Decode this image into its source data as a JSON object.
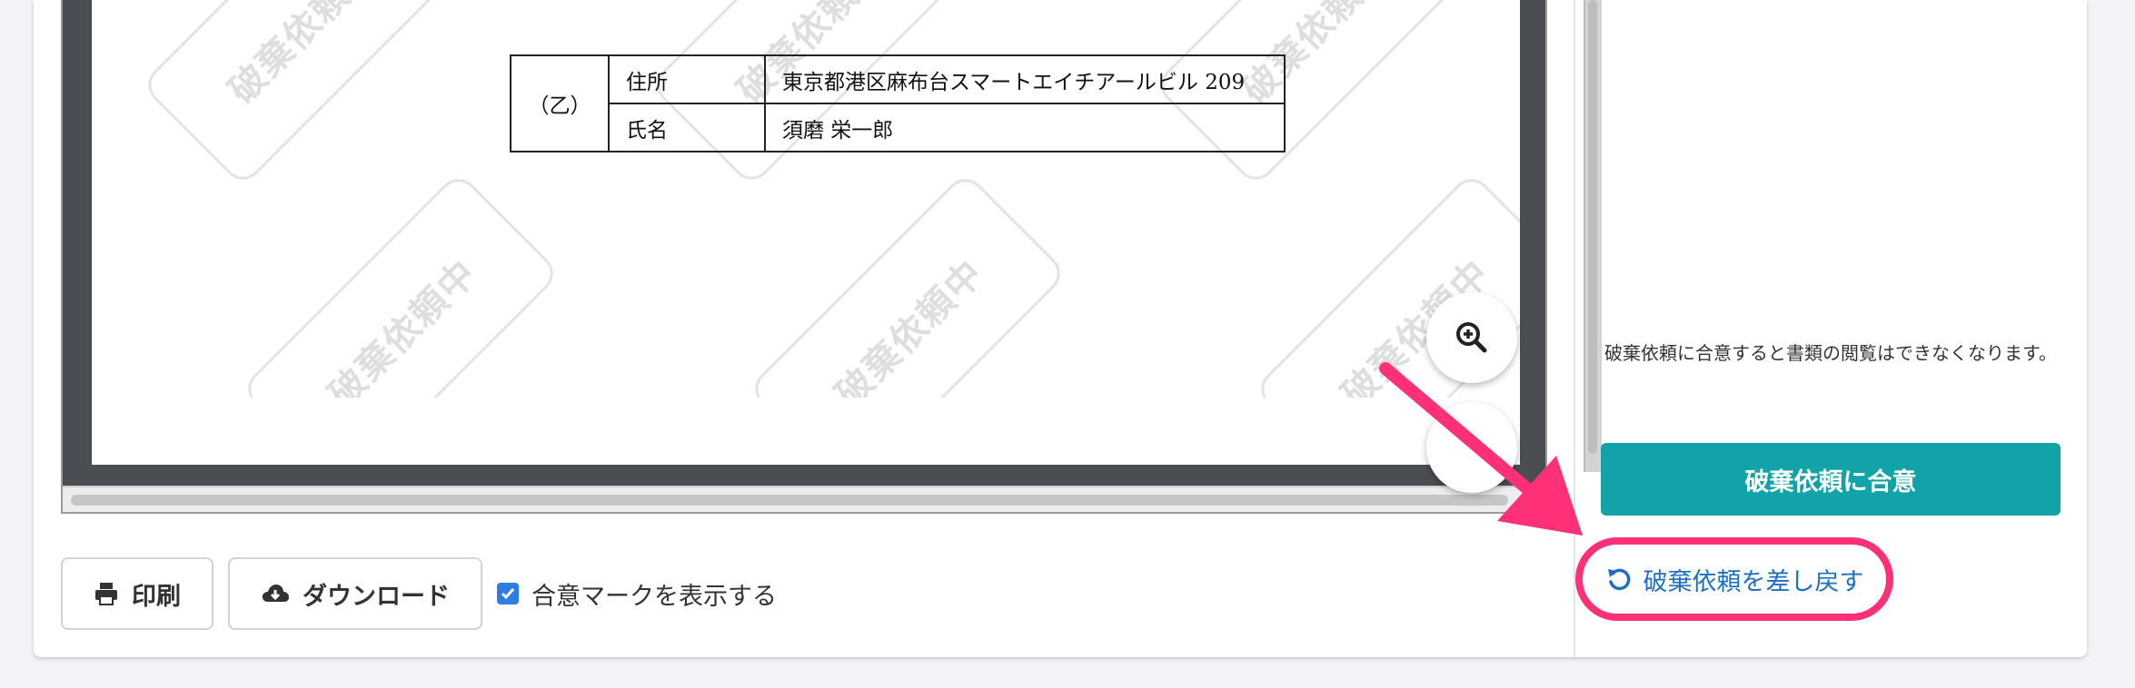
{
  "document": {
    "watermark_text": "破棄依頼中",
    "party_table": {
      "party_label": "（乙）",
      "rows": [
        {
          "label": "住所",
          "value": "東京都港区麻布台スマートエイチアールビル 209"
        },
        {
          "label": "氏名",
          "value": "須磨 栄一郎"
        }
      ]
    }
  },
  "toolbar": {
    "print_label": "印刷",
    "download_label": "ダウンロード",
    "show_agreement_mark_label": "合意マークを表示する",
    "show_agreement_mark_checked": true
  },
  "side_panel": {
    "notice_text": "破棄依頼に合意すると書類の閲覧はできなくなります。",
    "agree_button_label": "破棄依頼に合意",
    "return_link_label": "破棄依頼を差し戻す"
  },
  "colors": {
    "accent_teal": "#12a3a8",
    "link_blue": "#1d6fc4",
    "highlight_pink": "#ff2f78",
    "checkbox_blue": "#2f7de1"
  },
  "icons": [
    "zoom-in-icon",
    "printer-icon",
    "cloud-download-icon",
    "checkbox-checked-icon",
    "undo-arrow-icon"
  ]
}
